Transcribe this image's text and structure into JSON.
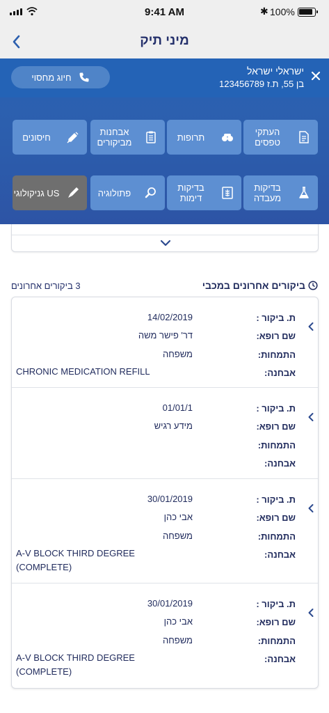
{
  "status_bar": {
    "time": "9:41 AM",
    "battery": "100%"
  },
  "nav": {
    "title": "מיני תיק"
  },
  "patient": {
    "name": "ישראלי ישראל",
    "info": "בן 55, ת.ז 123456789"
  },
  "dial_button": {
    "label": "חיוג מחסוי"
  },
  "tiles": [
    {
      "label": "העתקי טפסים",
      "icon": "document-icon"
    },
    {
      "label": "תרופות",
      "icon": "pills-icon"
    },
    {
      "label": "אבחנות מביקורים",
      "icon": "clipboard-icon"
    },
    {
      "label": "חיסונים",
      "icon": "syringe-icon"
    },
    {
      "label": "בדיקות מעבדה",
      "icon": "flask-icon"
    },
    {
      "label": "בדיקות דימות",
      "icon": "xray-icon"
    },
    {
      "label": "פתולוגיה",
      "icon": "microscope-icon"
    },
    {
      "label": "US גניקולוגי",
      "icon": "probe-icon"
    }
  ],
  "visits_section": {
    "title": "ביקורים אחרונים במכבי",
    "count": "3 ביקורים אחרונים",
    "labels": {
      "date": "ת. ביקור :",
      "doctor": "שם רופא:",
      "specialty": "התמחות:",
      "diagnosis": "אבחנה:"
    },
    "visits": [
      {
        "date": "14/02/2019",
        "doctor": "דר' פישר משה",
        "specialty": "משפחה",
        "diagnosis": "CHRONIC MEDICATION REFILL"
      },
      {
        "date": "01/01/1",
        "doctor": "מידע רגיש",
        "specialty": "",
        "diagnosis": ""
      },
      {
        "date": "30/01/2019",
        "doctor": "אבי כהן",
        "specialty": "משפחה",
        "diagnosis": "A-V BLOCK THIRD DEGREE (COMPLETE)"
      },
      {
        "date": "30/01/2019",
        "doctor": "אבי כהן",
        "specialty": "משפחה",
        "diagnosis": "A-V BLOCK THIRD DEGREE (COMPLETE)"
      }
    ]
  },
  "colors": {
    "header_blue": "#2a62b4",
    "tile_blue": "#5d8fd2",
    "tile_gray": "#6f6f6f",
    "text_navy": "#1f2a5c"
  }
}
